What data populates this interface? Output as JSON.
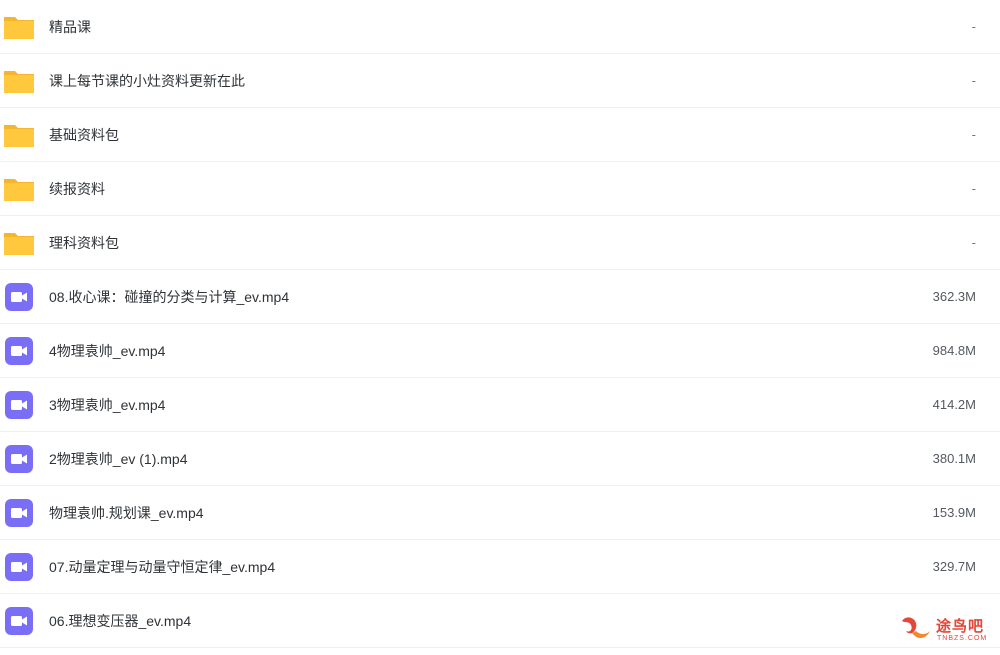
{
  "colors": {
    "folder": "#ffc83d",
    "folder_tab": "#f5b62e",
    "video": "#7b6ef6"
  },
  "files": [
    {
      "type": "folder",
      "icon": "folder-icon",
      "name": "精品课",
      "size": "-"
    },
    {
      "type": "folder",
      "icon": "folder-icon",
      "name": "课上每节课的小灶资料更新在此",
      "size": "-"
    },
    {
      "type": "folder",
      "icon": "folder-icon",
      "name": "基础资料包",
      "size": "-"
    },
    {
      "type": "folder",
      "icon": "folder-icon",
      "name": "续报资料",
      "size": "-"
    },
    {
      "type": "folder",
      "icon": "folder-icon",
      "name": "理科资料包",
      "size": "-"
    },
    {
      "type": "video",
      "icon": "video-file-icon",
      "name": "08.收心课：碰撞的分类与计算_ev.mp4",
      "size": "362.3M"
    },
    {
      "type": "video",
      "icon": "video-file-icon",
      "name": "4物理袁帅_ev.mp4",
      "size": "984.8M"
    },
    {
      "type": "video",
      "icon": "video-file-icon",
      "name": "3物理袁帅_ev.mp4",
      "size": "414.2M"
    },
    {
      "type": "video",
      "icon": "video-file-icon",
      "name": "2物理袁帅_ev (1).mp4",
      "size": "380.1M"
    },
    {
      "type": "video",
      "icon": "video-file-icon",
      "name": "物理袁帅.规划课_ev.mp4",
      "size": "153.9M"
    },
    {
      "type": "video",
      "icon": "video-file-icon",
      "name": "07.动量定理与动量守恒定律_ev.mp4",
      "size": "329.7M"
    },
    {
      "type": "video",
      "icon": "video-file-icon",
      "name": "06.理想变压器_ev.mp4",
      "size": ""
    }
  ],
  "watermark": {
    "text": "途鸟吧",
    "sub": "TNBZS.COM"
  }
}
